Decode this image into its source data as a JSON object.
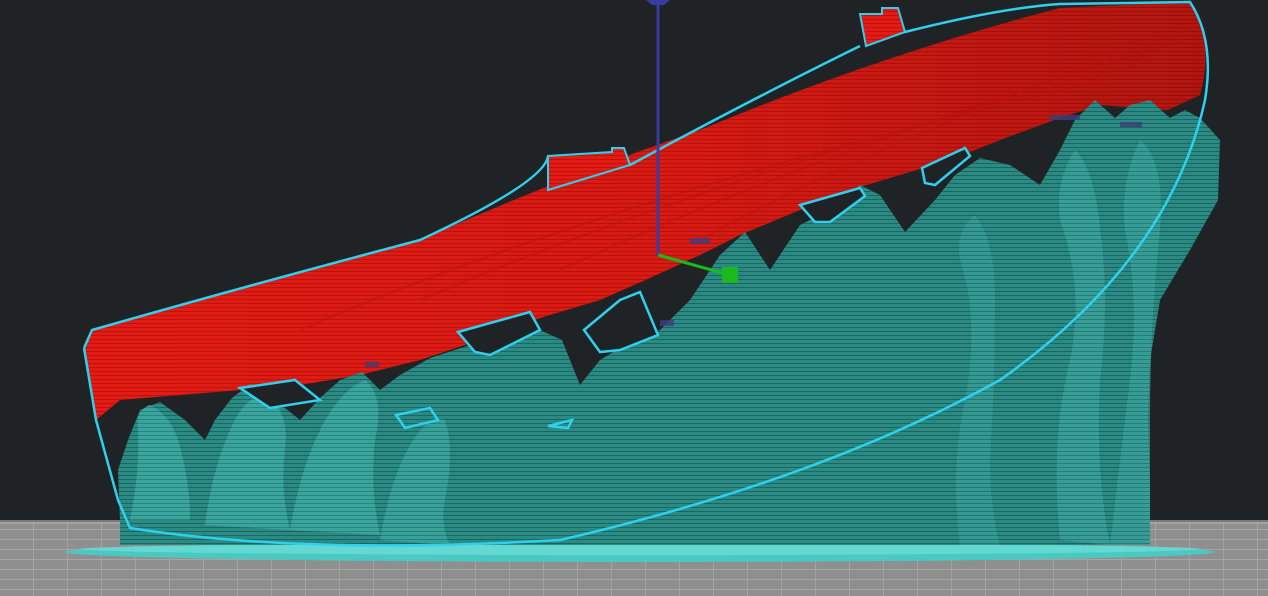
{
  "viewport": {
    "label": "",
    "background_color": "#1f2326",
    "bed_color": "#8e8e8e",
    "model_color": "#e31b14",
    "support_color": "#2a8a84",
    "outline_color": "#2fd0ee",
    "raft_color": "#49c9c1"
  },
  "gizmo": {
    "z_axis_color": "#3a3aa0",
    "y_axis_color": "#1db81d",
    "handle_icon": "square-handle-icon"
  }
}
